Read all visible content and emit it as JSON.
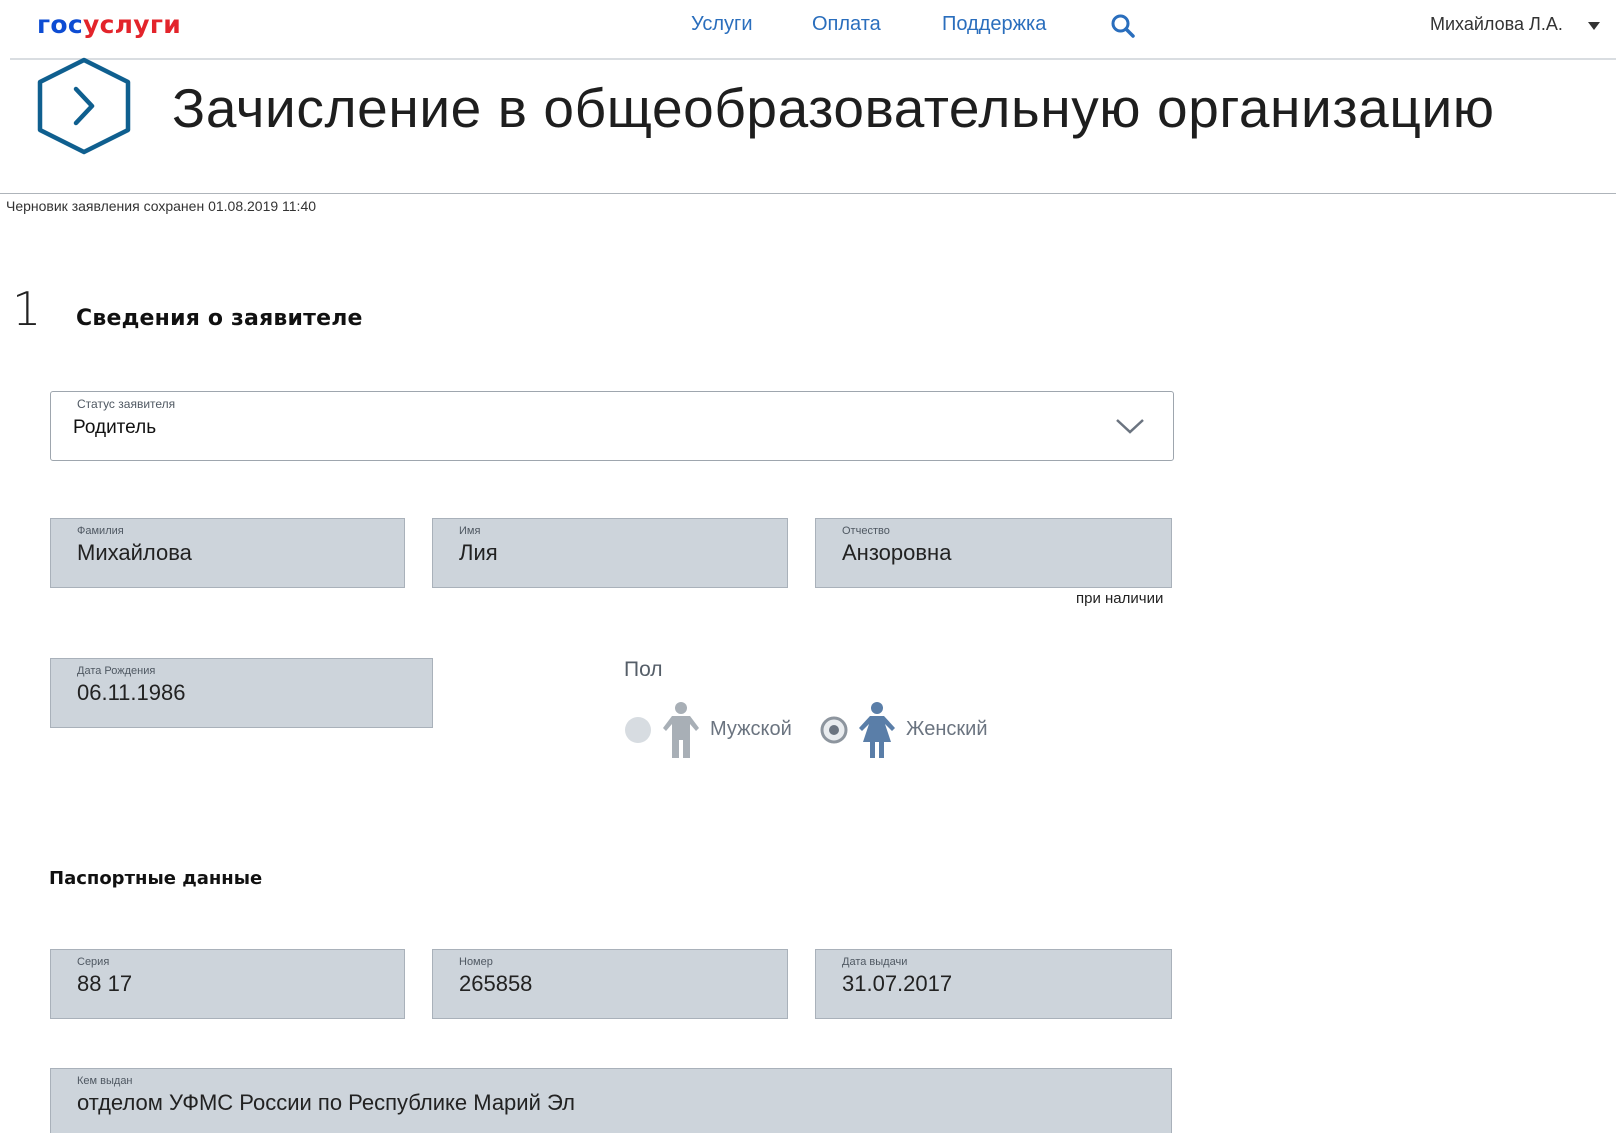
{
  "header": {
    "logo_part1": "гос",
    "logo_part2": "услуги",
    "nav": [
      "Услуги",
      "Оплата",
      "Поддержка"
    ],
    "user_name": "Михайлова Л.А.",
    "colors": {
      "logo_blue": "#0d4cd3",
      "logo_red": "#e3242b",
      "nav_link": "#2a6ebd"
    },
    "icons": {
      "search": "search-icon",
      "user_menu": "caret-down-icon",
      "service": "hexagon-chevron-right-icon"
    }
  },
  "page": {
    "title": "Зачисление в общеобразовательную организацию",
    "draft_note": "Черновик заявления сохранен 01.08.2019 11:40"
  },
  "step": {
    "number": "1",
    "title": "Сведения о заявителе"
  },
  "applicant": {
    "status": {
      "label": "Статус заявителя",
      "value": "Родитель"
    },
    "last_name": {
      "label": "Фамилия",
      "value": "Михайлова"
    },
    "first_name": {
      "label": "Имя",
      "value": "Лия"
    },
    "middle_name": {
      "label": "Отчество",
      "value": "Анзоровна",
      "hint": "при наличии"
    },
    "birth_date": {
      "label": "Дата Рождения",
      "value": "06.11.1986"
    },
    "gender": {
      "label": "Пол",
      "options": [
        {
          "label": "Мужской",
          "selected": false
        },
        {
          "label": "Женский",
          "selected": true
        }
      ]
    }
  },
  "passport": {
    "title": "Паспортные данные",
    "series": {
      "label": "Серия",
      "value": "88 17"
    },
    "number": {
      "label": "Номер",
      "value": "265858"
    },
    "issue_date": {
      "label": "Дата выдачи",
      "value": "31.07.2017"
    },
    "issued_by": {
      "label": "Кем выдан",
      "value": "отделом УФМС России по Республике Марий Эл"
    }
  },
  "colors": {
    "field_fill": "#cdd4db",
    "field_border": "#a9b1ba",
    "accent_icon": "#0f5f8f",
    "female_icon": "#5a7ea8",
    "male_icon": "#a8afb6"
  }
}
